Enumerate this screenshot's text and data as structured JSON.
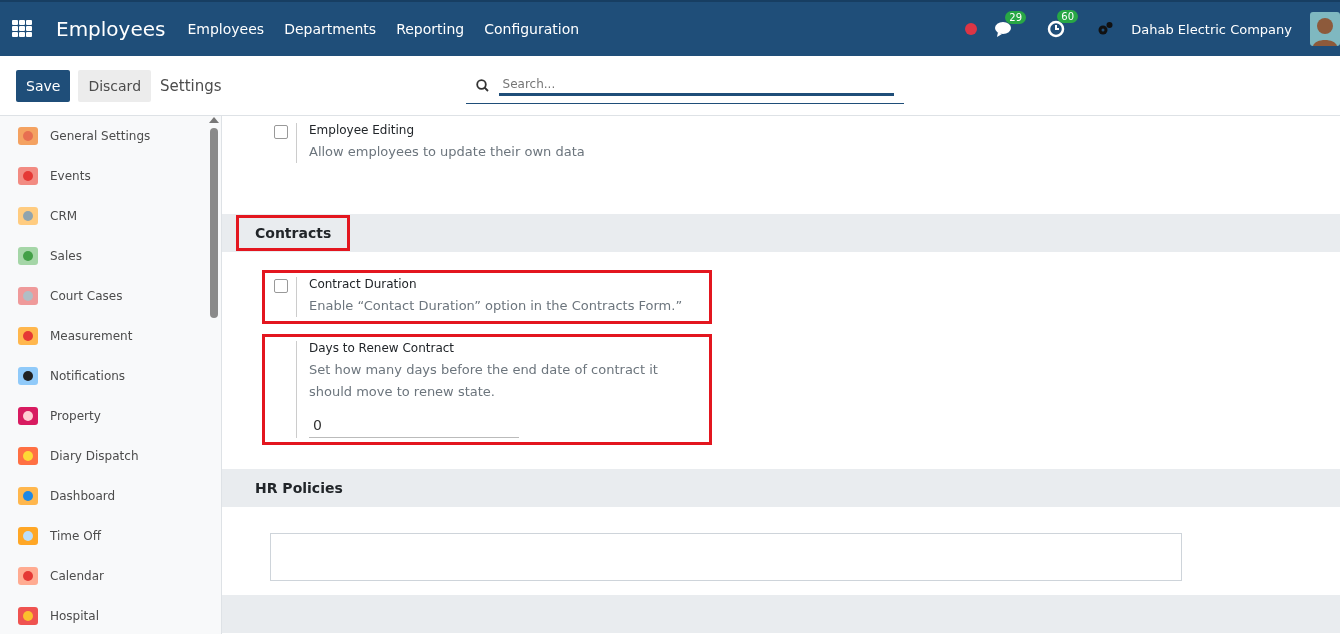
{
  "navbar": {
    "app_title": "Employees",
    "menu": [
      "Employees",
      "Departments",
      "Reporting",
      "Configuration"
    ],
    "messages_count": "29",
    "activities_count": "60",
    "company": "Dahab Electric Company"
  },
  "control_panel": {
    "save": "Save",
    "discard": "Discard",
    "breadcrumb": "Settings",
    "search": {
      "placeholder": "Search..."
    }
  },
  "sidebar": {
    "items": [
      {
        "label": "General Settings",
        "selected": false
      },
      {
        "label": "Events",
        "selected": false
      },
      {
        "label": "CRM",
        "selected": false
      },
      {
        "label": "Sales",
        "selected": false
      },
      {
        "label": "Court Cases",
        "selected": false
      },
      {
        "label": "Measurement",
        "selected": false
      },
      {
        "label": "Notifications",
        "selected": false
      },
      {
        "label": "Property",
        "selected": false
      },
      {
        "label": "Diary Dispatch",
        "selected": false
      },
      {
        "label": "Dashboard",
        "selected": false
      },
      {
        "label": "Time Off",
        "selected": false
      },
      {
        "label": "Calendar",
        "selected": false
      },
      {
        "label": "Hospital",
        "selected": false
      }
    ]
  },
  "sections": [
    {
      "kind": "plain",
      "settings": [
        {
          "kind": "checkbox",
          "title": "Employee Editing",
          "description": "Allow employees to update their own data",
          "checked": false,
          "highlighted": false
        }
      ]
    },
    {
      "kind": "titled",
      "title": "Contracts",
      "highlighted": true,
      "settings": [
        {
          "kind": "checkbox",
          "title": "Contract Duration",
          "description": "Enable “Contact Duration” option in the Contracts Form.”",
          "checked": false,
          "highlighted": true
        },
        {
          "kind": "input",
          "title": "Days to Renew Contract",
          "description": "Set how many days before the end date of contract it should move to renew state.",
          "value": "0",
          "highlighted": true
        }
      ]
    },
    {
      "kind": "titled",
      "title": "HR Policies",
      "highlighted": false,
      "settings": [
        {
          "kind": "empty_box"
        }
      ]
    }
  ]
}
